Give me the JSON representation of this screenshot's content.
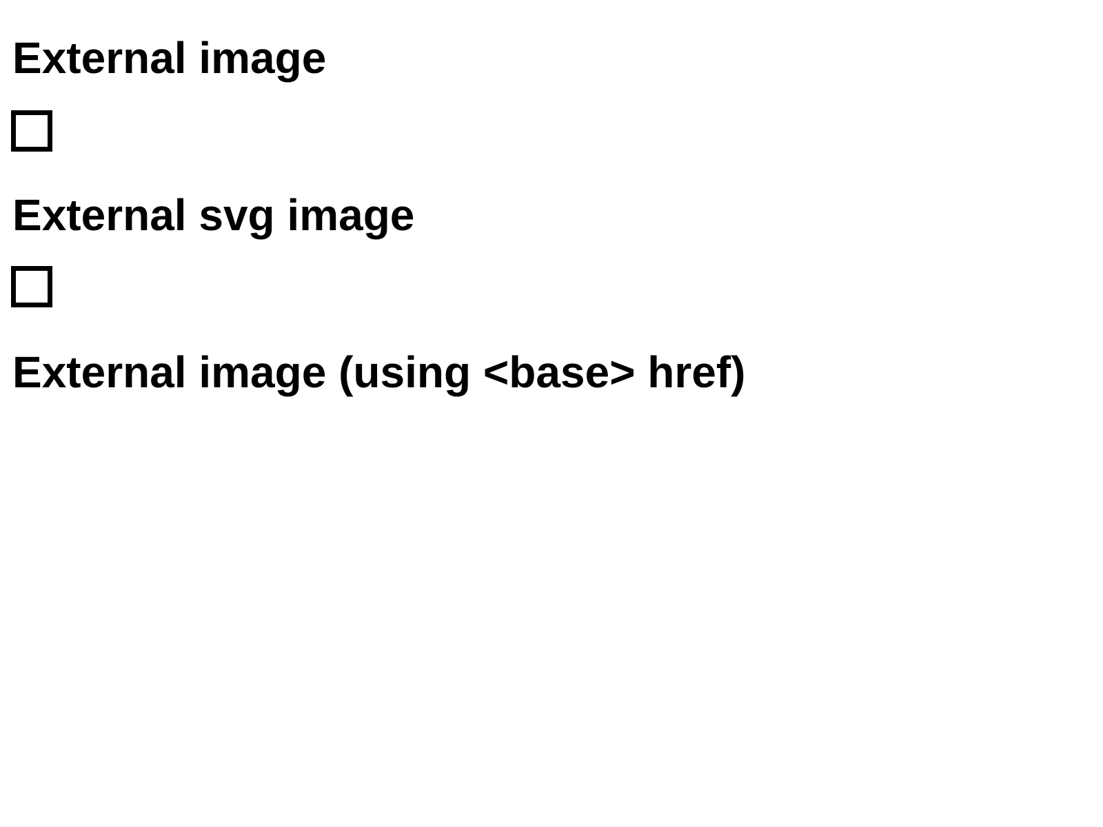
{
  "sections": [
    {
      "heading": "External image",
      "image_state": "broken-image-icon"
    },
    {
      "heading": "External svg image",
      "image_state": "broken-image-icon"
    },
    {
      "heading": "External image (using <base> href)"
    }
  ],
  "colors": {
    "background": "#ffffff",
    "text": "#000000",
    "image_border": "#000000"
  }
}
